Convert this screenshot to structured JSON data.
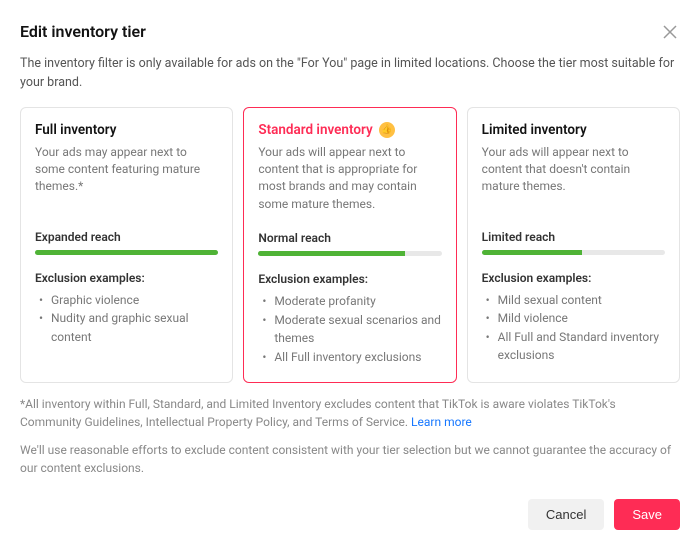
{
  "modal": {
    "title": "Edit inventory tier",
    "subtitle": "The inventory filter is only available for ads on the \"For You\" page in limited locations. Choose the tier most suitable for your brand."
  },
  "tiers": [
    {
      "title": "Full inventory",
      "desc": "Your ads may appear next to some content featuring mature themes.*",
      "reach_label": "Expanded reach",
      "reach_pct": 100,
      "exc_title": "Exclusion examples:",
      "exclusions": [
        "Graphic violence",
        "Nudity and graphic sexual content"
      ],
      "selected": false,
      "has_badge": false
    },
    {
      "title": "Standard inventory",
      "desc": "Your ads will appear next to content that is appropriate for most brands and may contain some mature themes.",
      "reach_label": "Normal reach",
      "reach_pct": 80,
      "exc_title": "Exclusion examples:",
      "exclusions": [
        "Moderate profanity",
        "Moderate sexual scenarios and themes",
        "All Full inventory exclusions"
      ],
      "selected": true,
      "has_badge": true
    },
    {
      "title": "Limited inventory",
      "desc": "Your ads will appear next to content that doesn't contain mature themes.",
      "reach_label": "Limited reach",
      "reach_pct": 55,
      "exc_title": "Exclusion examples:",
      "exclusions": [
        "Mild sexual content",
        "Mild violence",
        "All Full and Standard inventory exclusions"
      ],
      "selected": false,
      "has_badge": false
    }
  ],
  "footnote": {
    "text": "*All inventory within Full, Standard, and Limited Inventory excludes content that TikTok is aware violates TikTok's Community Guidelines, Intellectual Property Policy, and Terms of Service. ",
    "learn_more": "Learn more"
  },
  "footnote2": "We'll use reasonable efforts to exclude content consistent with your tier selection but we cannot guarantee the accuracy of our content exclusions.",
  "actions": {
    "cancel": "Cancel",
    "save": "Save"
  }
}
